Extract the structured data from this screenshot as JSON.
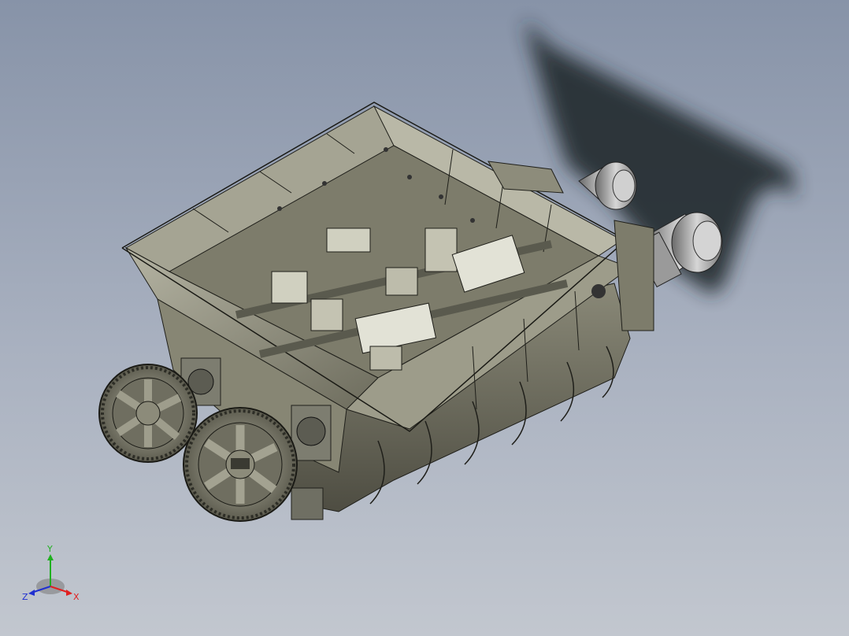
{
  "viewport": {
    "background_top": "#8793a8",
    "background_bottom": "#c2c7cf",
    "model_color": "#8f8e7c",
    "shadow_color": "#24292f"
  },
  "model": {
    "components": [
      "housing-frame",
      "mixing-shaft",
      "paddle-blade",
      "trough",
      "gear-wheel",
      "motor",
      "bearing-block"
    ]
  },
  "triad": {
    "x_label": "X",
    "y_label": "Y",
    "z_label": "Z",
    "x_color": "#e02020",
    "y_color": "#20b020",
    "z_color": "#2030d0"
  }
}
